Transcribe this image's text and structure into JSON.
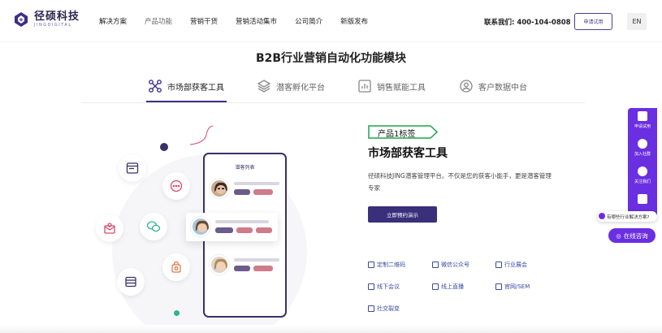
{
  "header": {
    "logo_cn": "径硕科技",
    "logo_en": "JINGDIGITAL",
    "nav": [
      "解决方案",
      "产品功能",
      "营销干货",
      "营销活动集市",
      "公司简介",
      "新版发布"
    ],
    "contact": "联系我们: 400-104-0808",
    "trial_label": "申请试用",
    "lang_label": "EN"
  },
  "section_title": "B2B行业营销自动化功能模块",
  "tabs": [
    {
      "label": "市场部获客工具",
      "icon": "network-icon",
      "active": true
    },
    {
      "label": "潜客孵化平台",
      "icon": "layers-icon",
      "active": false
    },
    {
      "label": "销售赋能工具",
      "icon": "chart-screen-icon",
      "active": false
    },
    {
      "label": "客户数据中台",
      "icon": "user-circle-icon",
      "active": false
    }
  ],
  "illustration": {
    "phone_title": "潜客列表"
  },
  "content": {
    "badge": "产品1标签",
    "heading": "市场部获客工具",
    "desc": "径硕科技JING潜客管理平台。不仅是您的获客小能手，更是潜客管理专家",
    "demo_label": "立即预约演示",
    "features": [
      "定制二维码",
      "微信公众号",
      "行业展会",
      "线下会议",
      "线上直播",
      "官网/SEM",
      "社交裂变"
    ]
  },
  "side": {
    "items": [
      "申请试用",
      "加入社群",
      "关注我们",
      ""
    ],
    "question": "有哪些行业解决方案?",
    "consult_label": "在线咨询"
  },
  "colors": {
    "brand": "#3a2f7a",
    "accent_purple": "#6a2fe0",
    "badge_green": "#1aa64a"
  }
}
